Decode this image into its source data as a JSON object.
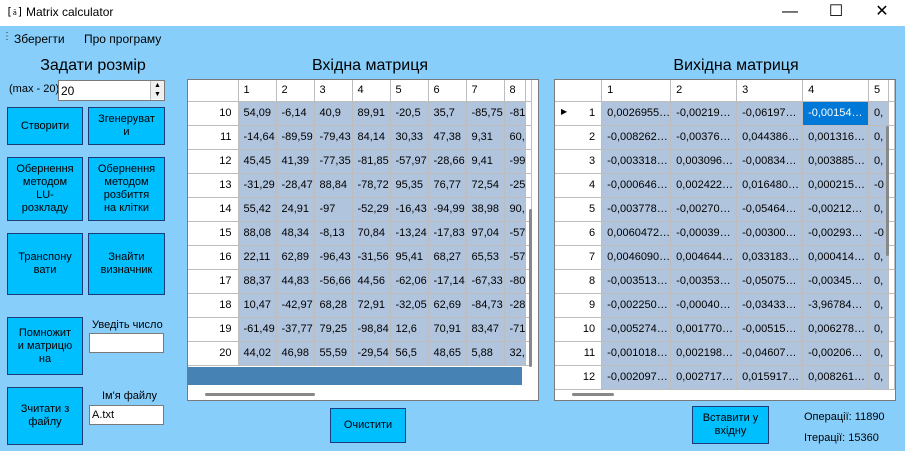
{
  "window": {
    "title": "Matrix calculator",
    "icon": "[ ]",
    "minimize": "—",
    "maximize": "☐",
    "close": "✕"
  },
  "menu": {
    "save": "Зберегти",
    "about": "Про програму"
  },
  "left": {
    "title": "Задати розмір",
    "max_label": "(max - 20)",
    "size_value": "20",
    "create_btn": "Створити",
    "generate_btn": "Згенеруват\nи",
    "lu_btn": "Обернення\nметодом\nLU-\nрозкладу",
    "block_btn": "Обернення\nметодом\nрозбиття\nна клітки",
    "transpose_btn": "Транспону\nвати",
    "det_btn": "Знайти\nвизначник",
    "multiply_btn": "Помножит\nи матрицю\nна",
    "number_label": "Уведіть число",
    "number_value": "",
    "read_btn": "Зчитати з\nфайлу",
    "filename_label": "Ім'я файлу",
    "filename_value": "A.txt"
  },
  "input_matrix": {
    "title": "Вхідна матриця",
    "columns": [
      "1",
      "2",
      "3",
      "4",
      "5",
      "6",
      "7",
      "8"
    ],
    "rows": [
      {
        "n": "10",
        "v": [
          "54,09",
          "-6,14",
          "40,9",
          "89,91",
          "-20,5",
          "35,7",
          "-85,75",
          "-81"
        ]
      },
      {
        "n": "11",
        "v": [
          "-14,64",
          "-89,59",
          "-79,43",
          "84,14",
          "30,33",
          "47,38",
          "9,31",
          "60,"
        ]
      },
      {
        "n": "12",
        "v": [
          "45,45",
          "41,39",
          "-77,35",
          "-81,85",
          "-57,97",
          "-28,66",
          "9,41",
          "-99"
        ]
      },
      {
        "n": "13",
        "v": [
          "-31,29",
          "-28,47",
          "88,84",
          "-78,72",
          "95,35",
          "76,77",
          "72,54",
          "-25"
        ]
      },
      {
        "n": "14",
        "v": [
          "55,42",
          "24,91",
          "-97",
          "-52,29",
          "-16,43",
          "-94,99",
          "38,98",
          "90,"
        ]
      },
      {
        "n": "15",
        "v": [
          "88,08",
          "48,34",
          "-8,13",
          "70,84",
          "-13,24",
          "-17,83",
          "97,04",
          "-57"
        ]
      },
      {
        "n": "16",
        "v": [
          "22,11",
          "62,89",
          "-96,43",
          "-31,56",
          "95,41",
          "68,27",
          "65,53",
          "-57"
        ]
      },
      {
        "n": "17",
        "v": [
          "88,37",
          "44,83",
          "-56,66",
          "44,56",
          "-62,06",
          "-17,14",
          "-67,33",
          "-80"
        ]
      },
      {
        "n": "18",
        "v": [
          "10,47",
          "-42,97",
          "68,28",
          "72,91",
          "-32,05",
          "62,69",
          "-84,73",
          "-28"
        ]
      },
      {
        "n": "19",
        "v": [
          "-61,49",
          "-37,77",
          "79,25",
          "-98,84",
          "12,6",
          "70,91",
          "83,47",
          "-71"
        ]
      },
      {
        "n": "20",
        "v": [
          "44,02",
          "46,98",
          "55,59",
          "-29,54",
          "56,5",
          "48,65",
          "5,88",
          "32,"
        ]
      }
    ]
  },
  "output_matrix": {
    "title": "Вихідна матриця",
    "columns": [
      "1",
      "2",
      "3",
      "4",
      "5"
    ],
    "rows": [
      {
        "n": "1",
        "v": [
          "0,0026955…",
          "-0,00219…",
          "-0,06197…",
          "-0,00154…",
          "0,"
        ]
      },
      {
        "n": "2",
        "v": [
          "-0,008262…",
          "-0,00376…",
          "0,044386…",
          "0,001316…",
          "0,"
        ]
      },
      {
        "n": "3",
        "v": [
          "-0,003318…",
          "0,003096…",
          "-0,00834…",
          "0,003885…",
          "0,"
        ]
      },
      {
        "n": "4",
        "v": [
          "-0,000646…",
          "0,002422…",
          "0,016480…",
          "0,000215…",
          "-0"
        ]
      },
      {
        "n": "5",
        "v": [
          "-0,003778…",
          "-0,00270…",
          "-0,05464…",
          "-0,00212…",
          "0,"
        ]
      },
      {
        "n": "6",
        "v": [
          "0,0060472…",
          "-0,00039…",
          "-0,00300…",
          "-0,00293…",
          "-0"
        ]
      },
      {
        "n": "7",
        "v": [
          "0,0046090…",
          "0,004644…",
          "0,033183…",
          "0,000414…",
          "0,"
        ]
      },
      {
        "n": "8",
        "v": [
          "-0,003513…",
          "-0,00353…",
          "-0,05075…",
          "-0,00345…",
          "0,"
        ]
      },
      {
        "n": "9",
        "v": [
          "-0,002250…",
          "-0,00040…",
          "-0,03433…",
          "-3,96784…",
          "0,"
        ]
      },
      {
        "n": "10",
        "v": [
          "-0,005274…",
          "0,001770…",
          "-0,00515…",
          "0,006278…",
          "0,"
        ]
      },
      {
        "n": "11",
        "v": [
          "-0,001018…",
          "0,002198…",
          "-0,04607…",
          "-0,00206…",
          "0,"
        ]
      },
      {
        "n": "12",
        "v": [
          "-0,002097…",
          "0,002717…",
          "0,015917…",
          "0,008261…",
          "0,"
        ]
      }
    ],
    "current_row_marker": "▶"
  },
  "actions": {
    "clear_btn": "Очистити",
    "insert_btn": "Вставити у\nвхідну"
  },
  "stats": {
    "operations": "Операції: 11890",
    "iterations": "Ітерації: 15360"
  }
}
